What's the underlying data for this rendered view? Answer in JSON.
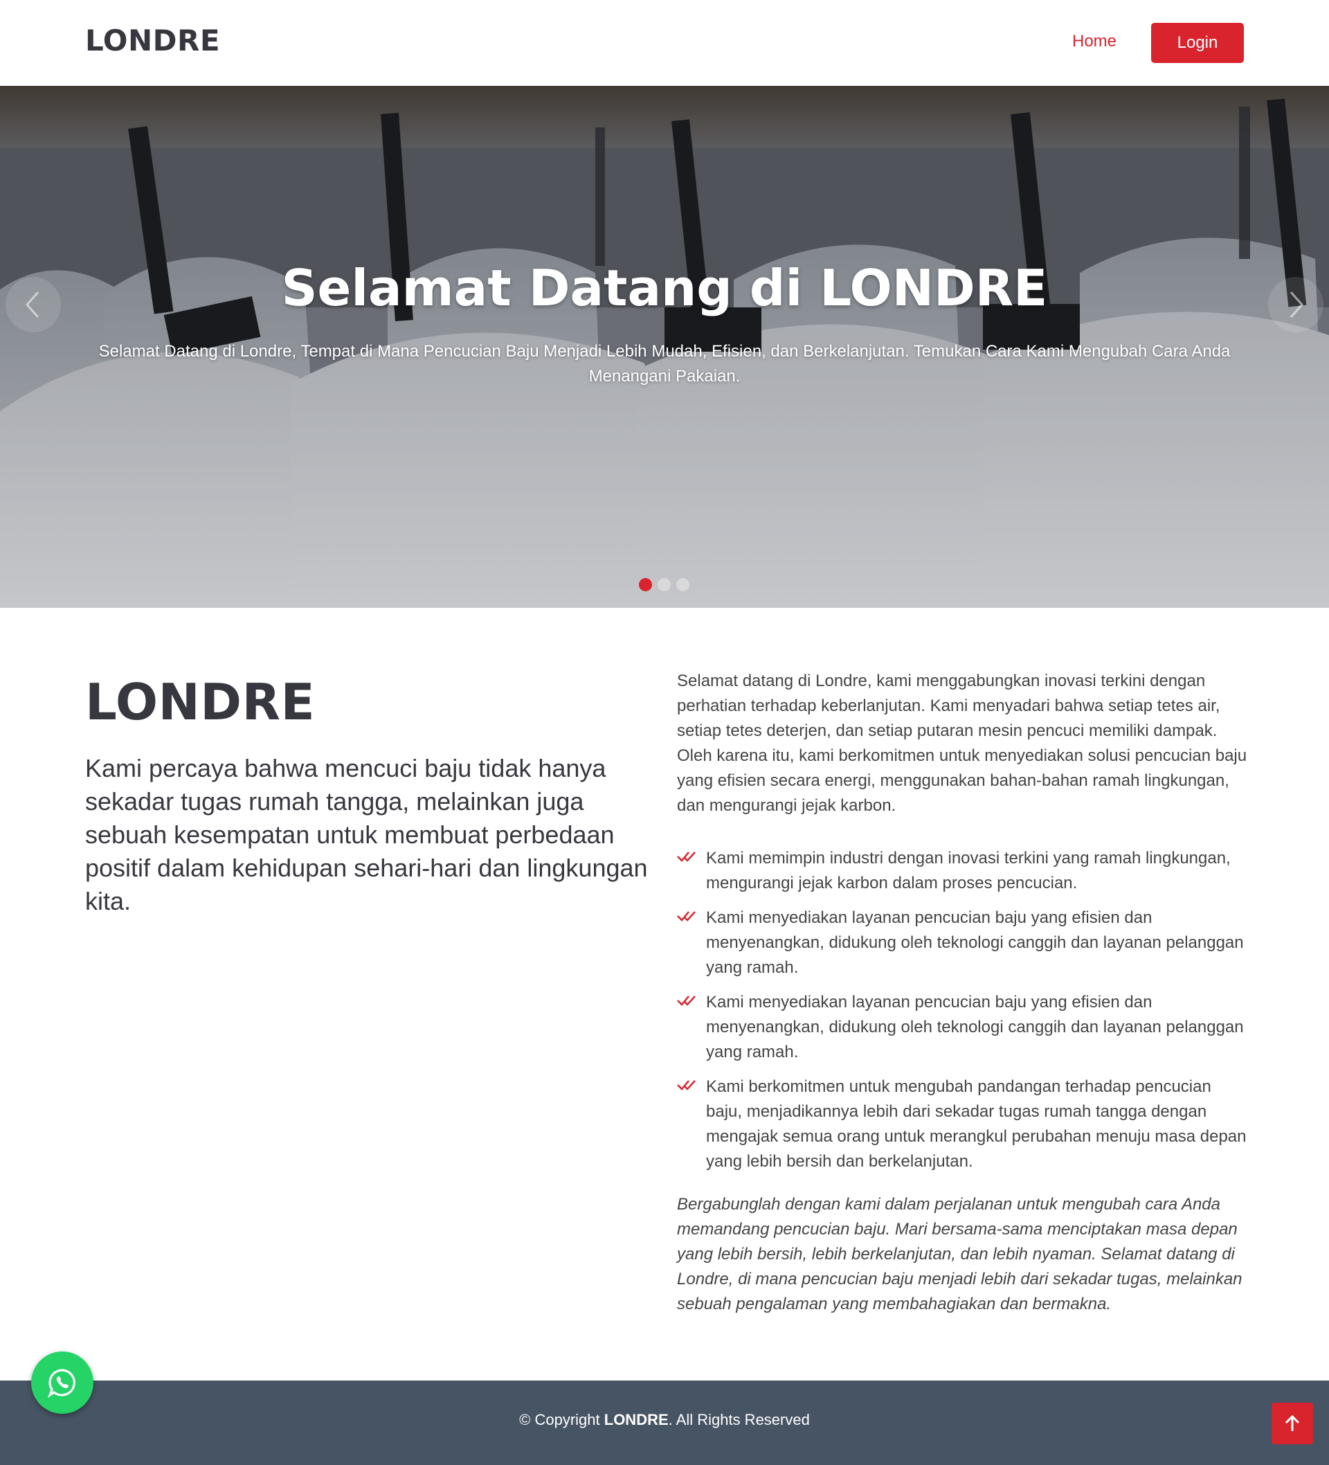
{
  "header": {
    "logo": "LONDRE",
    "nav": {
      "home": "Home",
      "login": "Login"
    }
  },
  "hero": {
    "title": "Selamat Datang di LONDRE",
    "subtitle": "Selamat Datang di Londre, Tempat di Mana Pencucian Baju Menjadi Lebih Mudah, Efisien, dan Berkelanjutan. Temukan Cara Kami Mengubah Cara Anda Menangani Pakaian.",
    "slides_total": 3,
    "active_slide": 1,
    "prev_icon": "chevron-left-icon",
    "next_icon": "chevron-right-icon"
  },
  "about": {
    "title": "LONDRE",
    "lead": "Kami percaya bahwa mencuci baju tidak hanya sekadar tugas rumah tangga, melainkan juga sebuah kesempatan untuk membuat perbedaan positif dalam kehidupan sehari-hari dan lingkungan kita.",
    "intro": "Selamat datang di Londre, kami menggabungkan inovasi terkini dengan perhatian terhadap keberlanjutan. Kami menyadari bahwa setiap tetes air, setiap tetes deterjen, dan setiap putaran mesin pencuci memiliki dampak. Oleh karena itu, kami berkomitmen untuk menyediakan solusi pencucian baju yang efisien secara energi, menggunakan bahan-bahan ramah lingkungan, dan mengurangi jejak karbon.",
    "features": [
      "Kami memimpin industri dengan inovasi terkini yang ramah lingkungan, mengurangi jejak karbon dalam proses pencucian.",
      "Kami menyediakan layanan pencucian baju yang efisien dan menyenangkan, didukung oleh teknologi canggih dan layanan pelanggan yang ramah.",
      "Kami menyediakan layanan pencucian baju yang efisien dan menyenangkan, didukung oleh teknologi canggih dan layanan pelanggan yang ramah.",
      "Kami berkomitmen untuk mengubah pandangan terhadap pencucian baju, menjadikannya lebih dari sekadar tugas rumah tangga dengan mengajak semua orang untuk merangkul perubahan menuju masa depan yang lebih bersih dan berkelanjutan."
    ],
    "closing": "Bergabunglah dengan kami dalam perjalanan untuk mengubah cara Anda memandang pencucian baju. Mari bersama-sama menciptakan masa depan yang lebih bersih, lebih berkelanjutan, dan lebih nyaman. Selamat datang di Londre, di mana pencucian baju menjadi lebih dari sekadar tugas, melainkan sebuah pengalaman yang membahagiakan dan bermakna."
  },
  "footer": {
    "copyright_prefix": "© Copyright ",
    "brand": "LONDRE",
    "copyright_suffix": ". All Rights Reserved"
  },
  "floating": {
    "whatsapp_icon": "whatsapp-icon",
    "back_to_top_icon": "arrow-up-icon"
  },
  "colors": {
    "accent": "#d9232d",
    "footer_bg": "#475463",
    "whatsapp": "#25d366",
    "text_dark": "#37373f"
  }
}
